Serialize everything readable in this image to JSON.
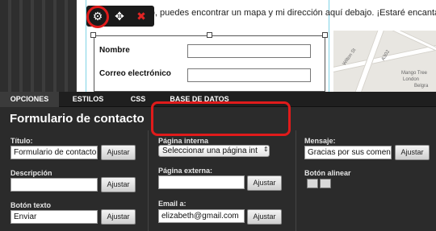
{
  "editor": {
    "intro_text": "visitar mi estudio, puedes encontrar un mapa y mi dirección aquí debajo. ¡Estaré encantada de",
    "form_fields": [
      {
        "label": "Nombre"
      },
      {
        "label": "Correo electrónico"
      }
    ],
    "map_labels": [
      "Wilton St",
      "A302",
      "Mango Tree",
      "London",
      "Belgra"
    ]
  },
  "toolbar": {
    "icons": [
      "gear-icon",
      "move-icon",
      "close-icon"
    ],
    "glyphs": {
      "gear": "⚙",
      "move": "✥",
      "close": "✖"
    },
    "close_color": "#e02424"
  },
  "tabs": [
    {
      "label": "OPCIONES",
      "active": true
    },
    {
      "label": "ESTILOS",
      "active": false
    },
    {
      "label": "CSS",
      "active": false
    },
    {
      "label": "BASE DE DATOS",
      "active": false
    }
  ],
  "panel": {
    "title": "Formulario de contacto",
    "titulo": {
      "label": "Título:",
      "value": "Formulario de contacto",
      "button": "Ajustar"
    },
    "descripcion": {
      "label": "Descripción",
      "value": "",
      "button": "Ajustar"
    },
    "boton_texto": {
      "label": "Botón texto",
      "value": "Enviar",
      "button": "Ajustar"
    },
    "pagina_interna": {
      "label": "Página interna",
      "selected": "Seleccionar una página int"
    },
    "pagina_externa": {
      "label": "Página externa:",
      "value": "",
      "button": "Ajustar"
    },
    "email": {
      "label": "Email a:",
      "value": "elizabeth@gmail.com",
      "button": "Ajustar"
    },
    "mensaje": {
      "label": "Mensaje:",
      "value": "Gracias por sus coment",
      "button": "Ajustar"
    },
    "boton_alinear": {
      "label": "Botón alinear"
    }
  },
  "colors": {
    "highlight": "#e01b1b",
    "panel_bg": "#2b2b2b",
    "tab_active": "#3b3b3b"
  }
}
